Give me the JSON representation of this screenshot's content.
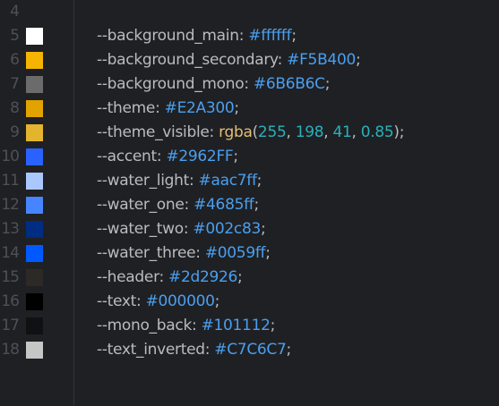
{
  "editor": {
    "lines": [
      {
        "num": "4",
        "prop": "",
        "value": "",
        "swatch": null
      },
      {
        "num": "5",
        "prop": "--background_main",
        "value": "#ffffff",
        "swatch": "#ffffff"
      },
      {
        "num": "6",
        "prop": "--background_secondary",
        "value": "#F5B400",
        "swatch": "#F5B400"
      },
      {
        "num": "7",
        "prop": "--background_mono",
        "value": "#6B6B6C",
        "swatch": "#6B6B6C"
      },
      {
        "num": "8",
        "prop": "--theme",
        "value": "#E2A300",
        "swatch": "#E2A300"
      },
      {
        "num": "9",
        "prop": "--theme_visible",
        "fn": "rgba",
        "args": [
          "255",
          "198",
          "41",
          "0.85"
        ],
        "swatch": "#e3b42e"
      },
      {
        "num": "10",
        "prop": "--accent",
        "value": "#2962FF",
        "swatch": "#2962FF"
      },
      {
        "num": "11",
        "prop": "--water_light",
        "value": "#aac7ff",
        "swatch": "#aac7ff"
      },
      {
        "num": "12",
        "prop": "--water_one",
        "value": "#4685ff",
        "swatch": "#4685ff"
      },
      {
        "num": "13",
        "prop": "--water_two",
        "value": "#002c83",
        "swatch": "#002c83"
      },
      {
        "num": "14",
        "prop": "--water_three",
        "value": "#0059ff",
        "swatch": "#0059ff"
      },
      {
        "num": "15",
        "prop": "--header",
        "value": "#2d2926",
        "swatch": "#2d2926"
      },
      {
        "num": "16",
        "prop": "--text",
        "value": "#000000",
        "swatch": "#000000"
      },
      {
        "num": "17",
        "prop": "--mono_back",
        "value": "#101112",
        "swatch": "#101112"
      },
      {
        "num": "18",
        "prop": "--text_inverted",
        "value": "#C7C6C7",
        "swatch": "#C7C6C7"
      }
    ]
  }
}
